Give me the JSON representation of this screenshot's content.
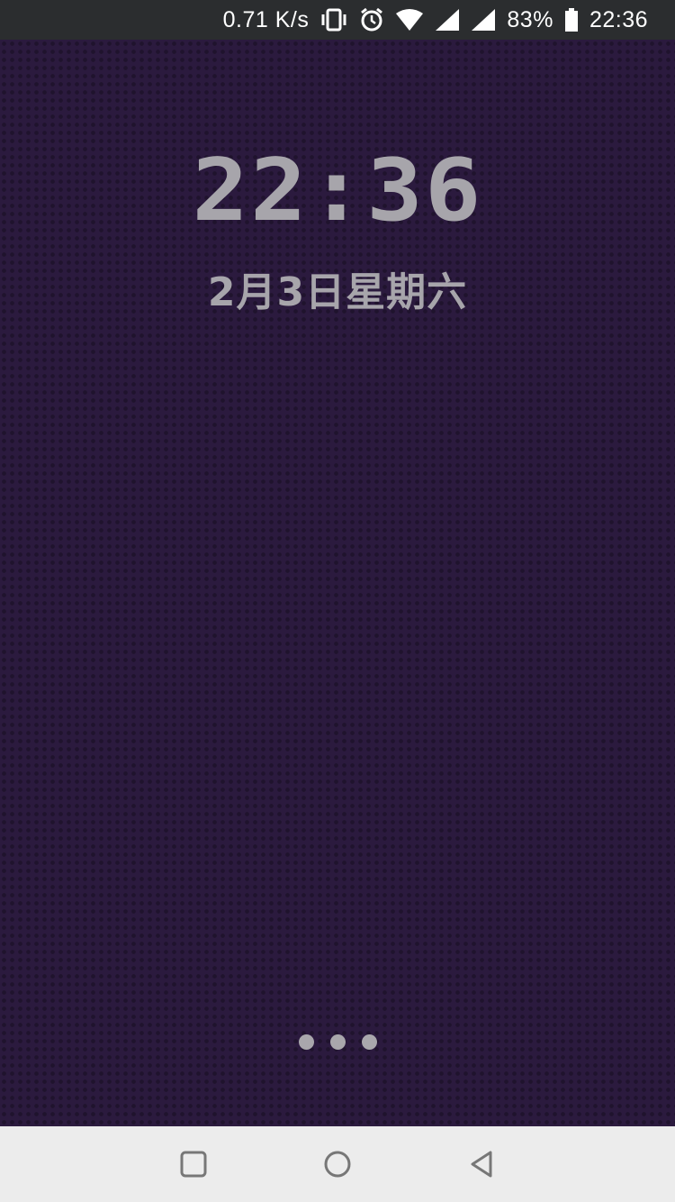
{
  "status_bar": {
    "network_speed": "0.71 K/s",
    "battery_percent": "83%",
    "time": "22:36",
    "icons": [
      "vibrate-icon",
      "alarm-icon",
      "wifi-icon",
      "signal-icon",
      "signal-icon",
      "battery-icon"
    ]
  },
  "lockscreen": {
    "time": "22:36",
    "date": "2月3日星期六",
    "page_indicator": {
      "count": 3
    }
  },
  "nav_bar": {
    "buttons": [
      "recents-button",
      "home-button",
      "back-button"
    ]
  }
}
